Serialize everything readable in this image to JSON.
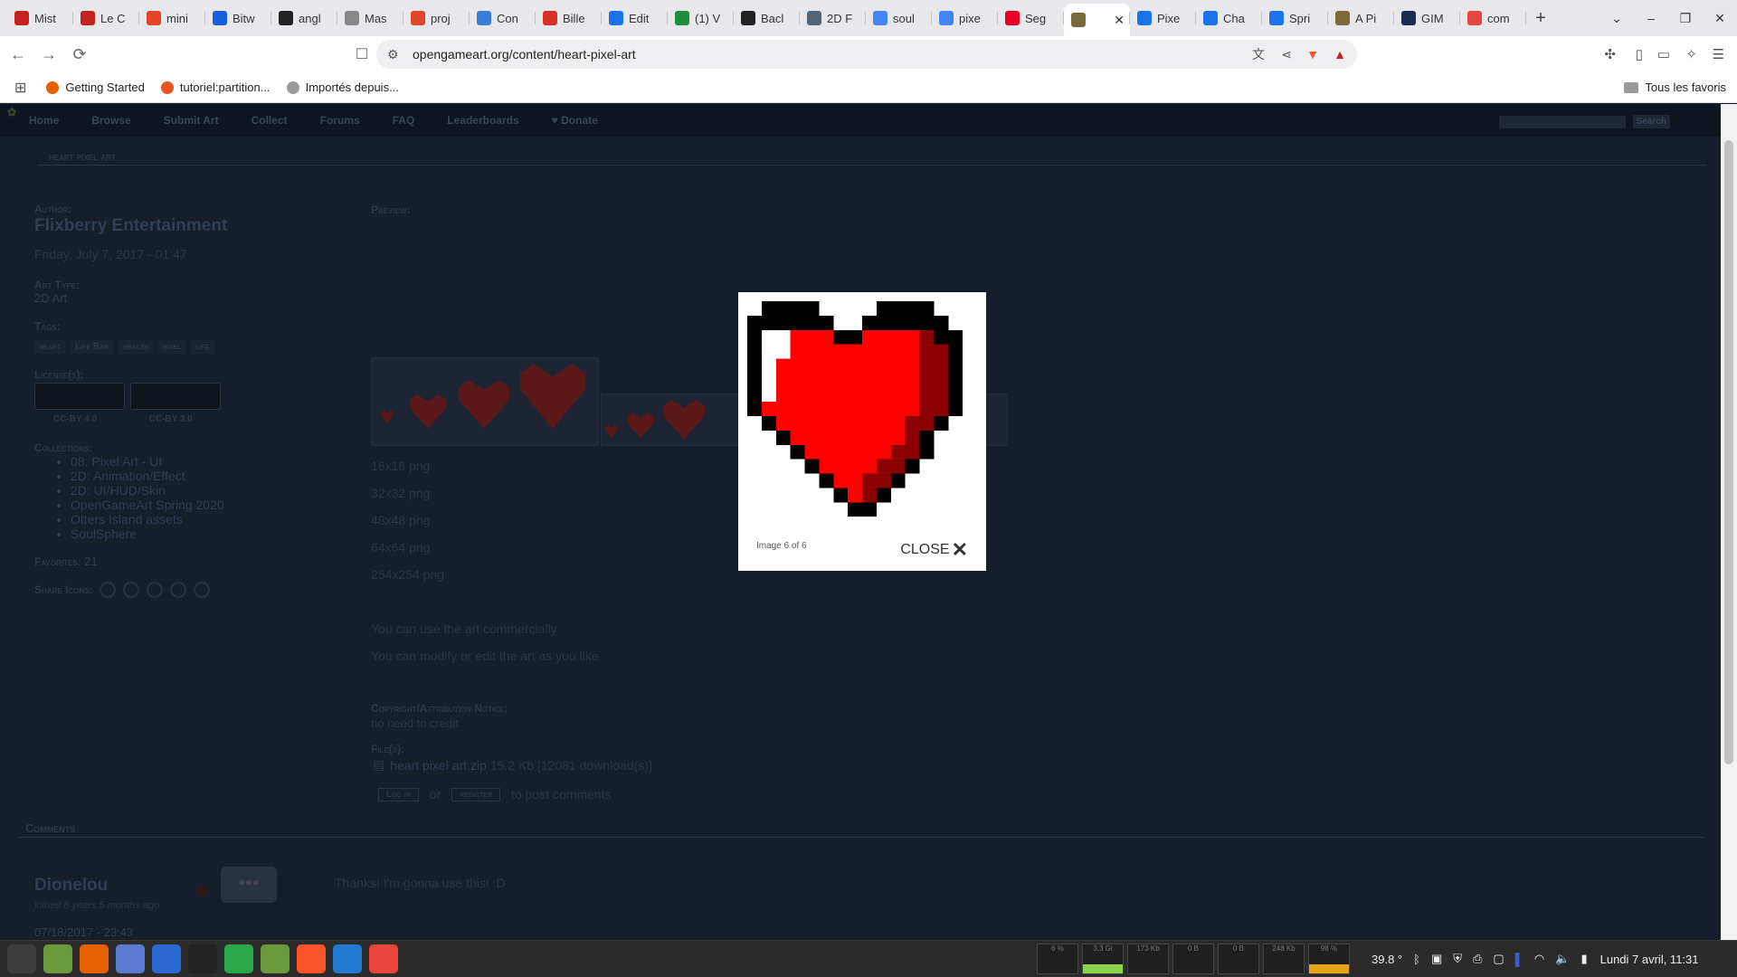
{
  "browser": {
    "tabs": [
      {
        "label": "Mist",
        "icon": "gmail-icon",
        "color": "#c5221f"
      },
      {
        "label": "Le C",
        "icon": "gmail-icon",
        "color": "#c5221f"
      },
      {
        "label": "mini",
        "icon": "gitlab-icon",
        "color": "#e24329"
      },
      {
        "label": "Bitw",
        "icon": "bitwarden-icon",
        "color": "#175ddc"
      },
      {
        "label": "angl",
        "icon": "chatgpt-icon",
        "color": "#222222"
      },
      {
        "label": "Mas",
        "icon": "chatgpt-icon",
        "color": "#888888"
      },
      {
        "label": "proj",
        "icon": "gitlab-icon",
        "color": "#e24329"
      },
      {
        "label": "Con",
        "icon": "settings-icon",
        "color": "#3b7ddd"
      },
      {
        "label": "Bille",
        "icon": "ticket-icon",
        "color": "#d93025"
      },
      {
        "label": "Edit",
        "icon": "play-icon",
        "color": "#1a73e8"
      },
      {
        "label": "(1) V",
        "icon": "status-icon",
        "color": "#1e8e3e"
      },
      {
        "label": "Bacl",
        "icon": "github-icon",
        "color": "#222222"
      },
      {
        "label": "2D F",
        "icon": "image-icon",
        "color": "#556677"
      },
      {
        "label": "soul",
        "icon": "google-icon",
        "color": "#4285f4"
      },
      {
        "label": "pixe",
        "icon": "google-icon",
        "color": "#4285f4"
      },
      {
        "label": "Seg",
        "icon": "pinterest-icon",
        "color": "#e60023"
      },
      {
        "label": "",
        "icon": "opengameart-icon",
        "color": "#7a6a3a",
        "active": true
      },
      {
        "label": "Pixe",
        "icon": "w-icon",
        "color": "#1a73e8"
      },
      {
        "label": "Cha",
        "icon": "w-icon",
        "color": "#1a73e8"
      },
      {
        "label": "Spri",
        "icon": "w-icon",
        "color": "#1a73e8"
      },
      {
        "label": "A Pi",
        "icon": "opengameart-icon",
        "color": "#7a6a3a"
      },
      {
        "label": "GIM",
        "icon": "f-icon",
        "color": "#1b2c54"
      },
      {
        "label": "com",
        "icon": "target-icon",
        "color": "#e8453c"
      }
    ],
    "url": "opengameart.org/content/heart-pixel-art",
    "bookmarks": [
      {
        "label": "Getting Started",
        "icon": "firefox-icon",
        "color": "#e66000"
      },
      {
        "label": "tutoriel:partition...",
        "icon": "ubuntu-icon",
        "color": "#e95420"
      },
      {
        "label": "Importés depuis...",
        "icon": "folder-icon",
        "color": "#9a9a9a"
      }
    ],
    "all_bookmarks_label": "Tous les favoris"
  },
  "site": {
    "nav": [
      "Home",
      "Browse",
      "Submit Art",
      "Collect",
      "Forums",
      "FAQ",
      "Leaderboards",
      "♥ Donate"
    ],
    "search_button": "Search",
    "breadcrumb": "heart pixel art",
    "author_label": "Author:",
    "author": "Flixberry Entertainment",
    "date": "Friday, July 7, 2017 - 01:47",
    "art_type_label": "Art Type:",
    "art_type": "2D Art",
    "tags_label": "Tags:",
    "tags": [
      "heart",
      "Life Bar",
      "health",
      "pixel",
      "life"
    ],
    "license_label": "License(s):",
    "licenses": [
      "CC-BY 4.0",
      "CC-BY 3.0"
    ],
    "collections_label": "Collections:",
    "collections": [
      "08. Pixel Art - UI",
      "2D: Animation/Effect",
      "2D: UI/HUD/Skin",
      "OpenGameArt Spring 2020",
      "Otters Island assets",
      "SoulSphere"
    ],
    "favorites_label": "Favorites:",
    "favorites": "21",
    "share_label": "Share Icons:",
    "preview_label": "Preview:",
    "sizes": [
      "16x16 png",
      "32x32 png",
      "48x48 png",
      "64x64 png",
      "254x254 png"
    ],
    "use_commercial": "You can use the art commercially",
    "use_modify": "You can modify or edit the art as you like",
    "copyright_label": "Copyright/Attribution Notice:",
    "copyright": "no need to credit",
    "files_label": "File(s):",
    "file_name": "heart pixel art.zip",
    "file_meta": "15.2 Kb [12081 download(s)]",
    "login": "Log in",
    "or": "or",
    "register": "register",
    "post_comments": "to post comments",
    "comments_label": "Comments",
    "comment": {
      "user": "Dionelou",
      "joined": "joined 8 years 5 months ago",
      "date": "07/18/2017 - 23:43",
      "text": "Thanks! I'm gonna use this! :D"
    }
  },
  "lightbox": {
    "caption": "Image 6 of 6",
    "close_label": "CLOSE"
  },
  "taskbar": {
    "apps": [
      "mint-menu-icon",
      "files-icon",
      "firefox-icon",
      "mail-icon",
      "writer-icon",
      "terminal-icon",
      "calc-icon",
      "folder-icon",
      "brave-icon",
      "vscode-icon",
      "gitkraken-icon"
    ],
    "temperature": "39.8 °",
    "datetime": "Lundi 7 avril, 11:31",
    "graphs": [
      "6 %",
      "3,3 Gi",
      "173 Kb",
      "0 B",
      "0 B",
      "248 Kb",
      "98 %"
    ]
  }
}
